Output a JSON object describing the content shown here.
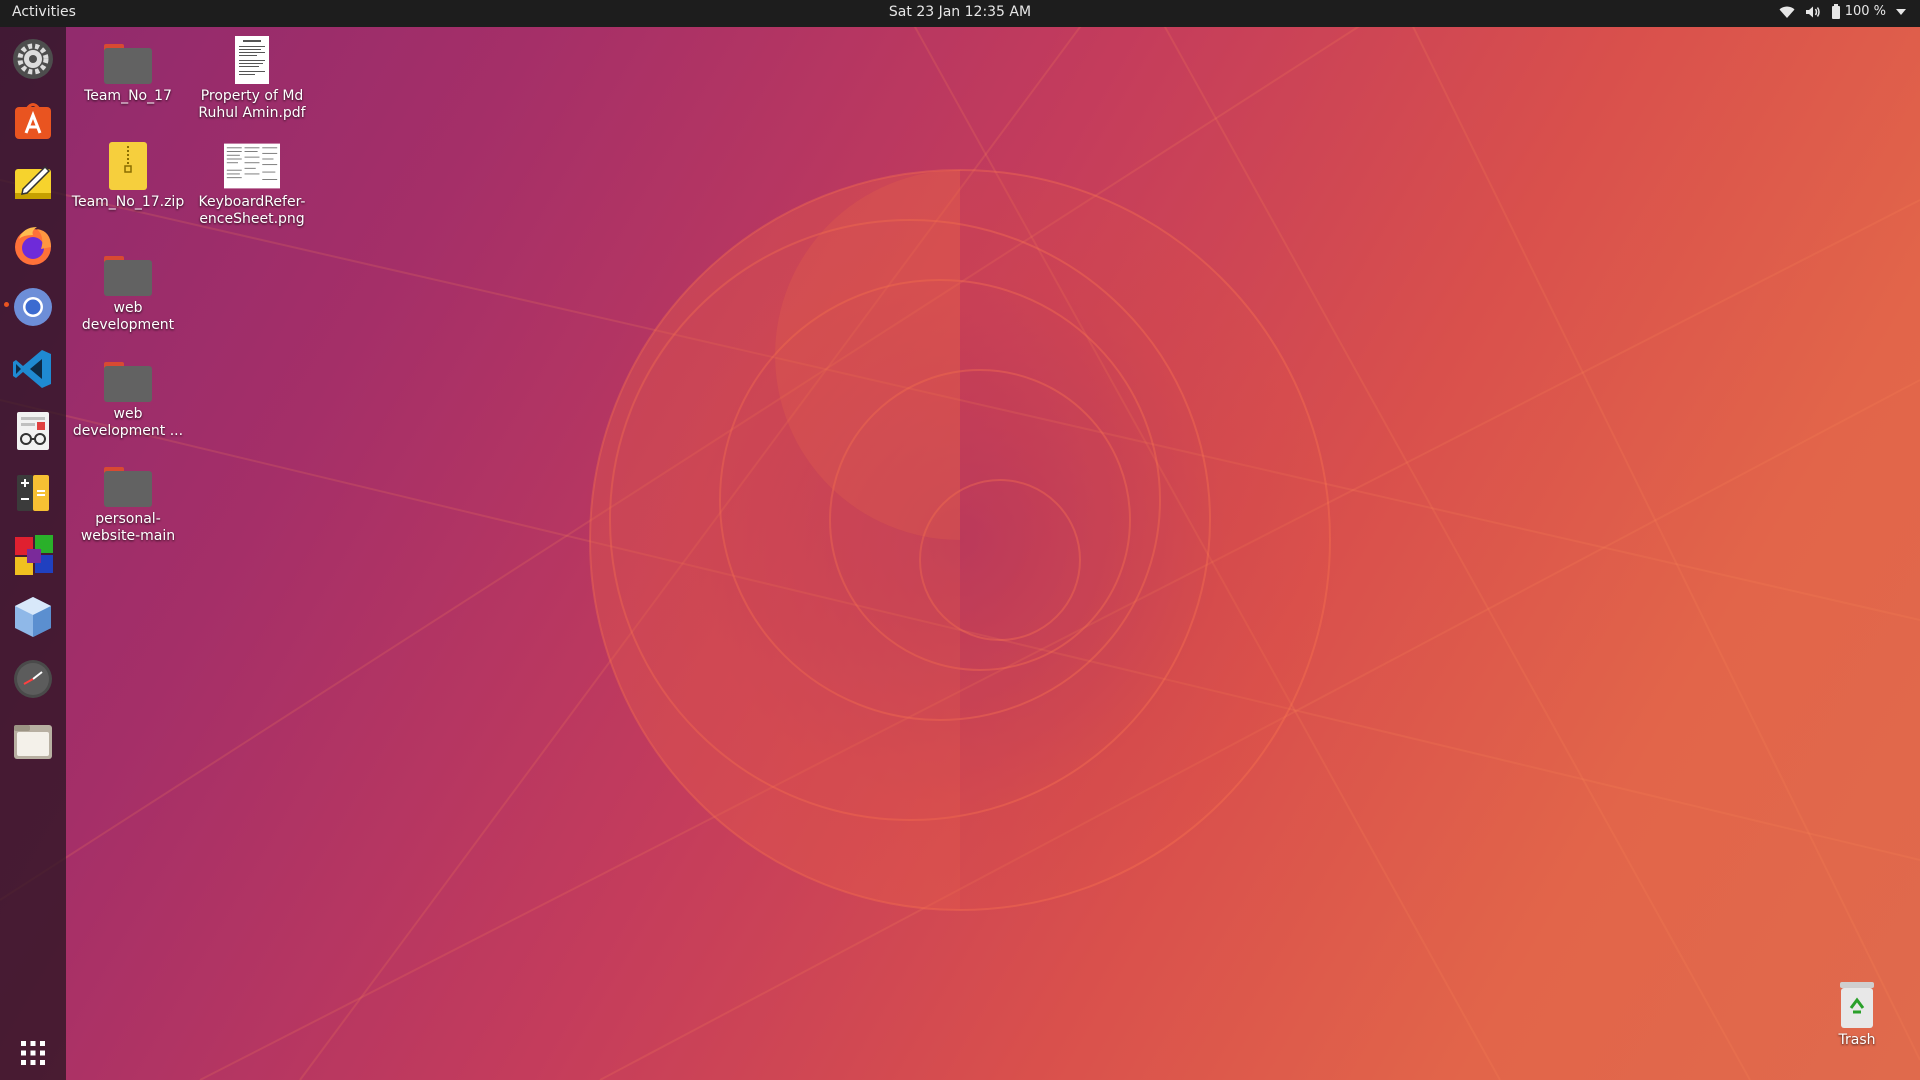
{
  "topbar": {
    "activities_label": "Activities",
    "clock": "Sat 23 Jan  12:35 AM",
    "battery_percent": "100 %",
    "icons": [
      "wifi-icon",
      "volume-icon",
      "battery-icon",
      "chevron-down-icon"
    ]
  },
  "dock": {
    "items": [
      {
        "name": "settings",
        "icon": "gear-icon",
        "running": false
      },
      {
        "name": "ubuntu-software",
        "icon": "software-store-icon",
        "running": false
      },
      {
        "name": "text-editor",
        "icon": "pencil-note-icon",
        "running": false
      },
      {
        "name": "firefox",
        "icon": "firefox-icon",
        "running": false
      },
      {
        "name": "chromium",
        "icon": "chromium-icon",
        "running": true
      },
      {
        "name": "vscode",
        "icon": "vscode-icon",
        "running": false
      },
      {
        "name": "document-viewer",
        "icon": "document-viewer-icon",
        "running": false
      },
      {
        "name": "calculator",
        "icon": "calculator-icon",
        "running": false
      },
      {
        "name": "color-app",
        "icon": "color-blocks-icon",
        "running": false
      },
      {
        "name": "virtualbox",
        "icon": "cube-icon",
        "running": false
      },
      {
        "name": "clocks",
        "icon": "clock-icon",
        "running": false
      },
      {
        "name": "files",
        "icon": "folder-icon",
        "running": false
      }
    ],
    "show_apps_icon": "app-grid-icon"
  },
  "desktop": {
    "icons": [
      {
        "label": "Team_No_17",
        "type": "folder",
        "icon": "folder-icon"
      },
      {
        "label": "Property of Md Ruhul Amin.pdf",
        "type": "pdf",
        "icon": "pdf-document-icon"
      },
      {
        "label": "Team_No_17.zip",
        "type": "zip",
        "icon": "zip-archive-icon"
      },
      {
        "label": "KeyboardRefer-enceSheet.png",
        "type": "image",
        "icon": "image-thumbnail-icon"
      },
      {
        "label": "web development",
        "type": "folder",
        "icon": "folder-icon"
      },
      {
        "label": "web development ...",
        "type": "folder",
        "icon": "folder-icon"
      },
      {
        "label": "personal-website-main",
        "type": "folder",
        "icon": "folder-icon"
      }
    ],
    "trash": {
      "label": "Trash",
      "icon": "trash-icon"
    }
  },
  "colors": {
    "accent": "#e95420",
    "topbar_bg": "#1d1d1d",
    "wallpaper_start": "#8e2a6e",
    "wallpaper_end": "#e06a4c"
  }
}
